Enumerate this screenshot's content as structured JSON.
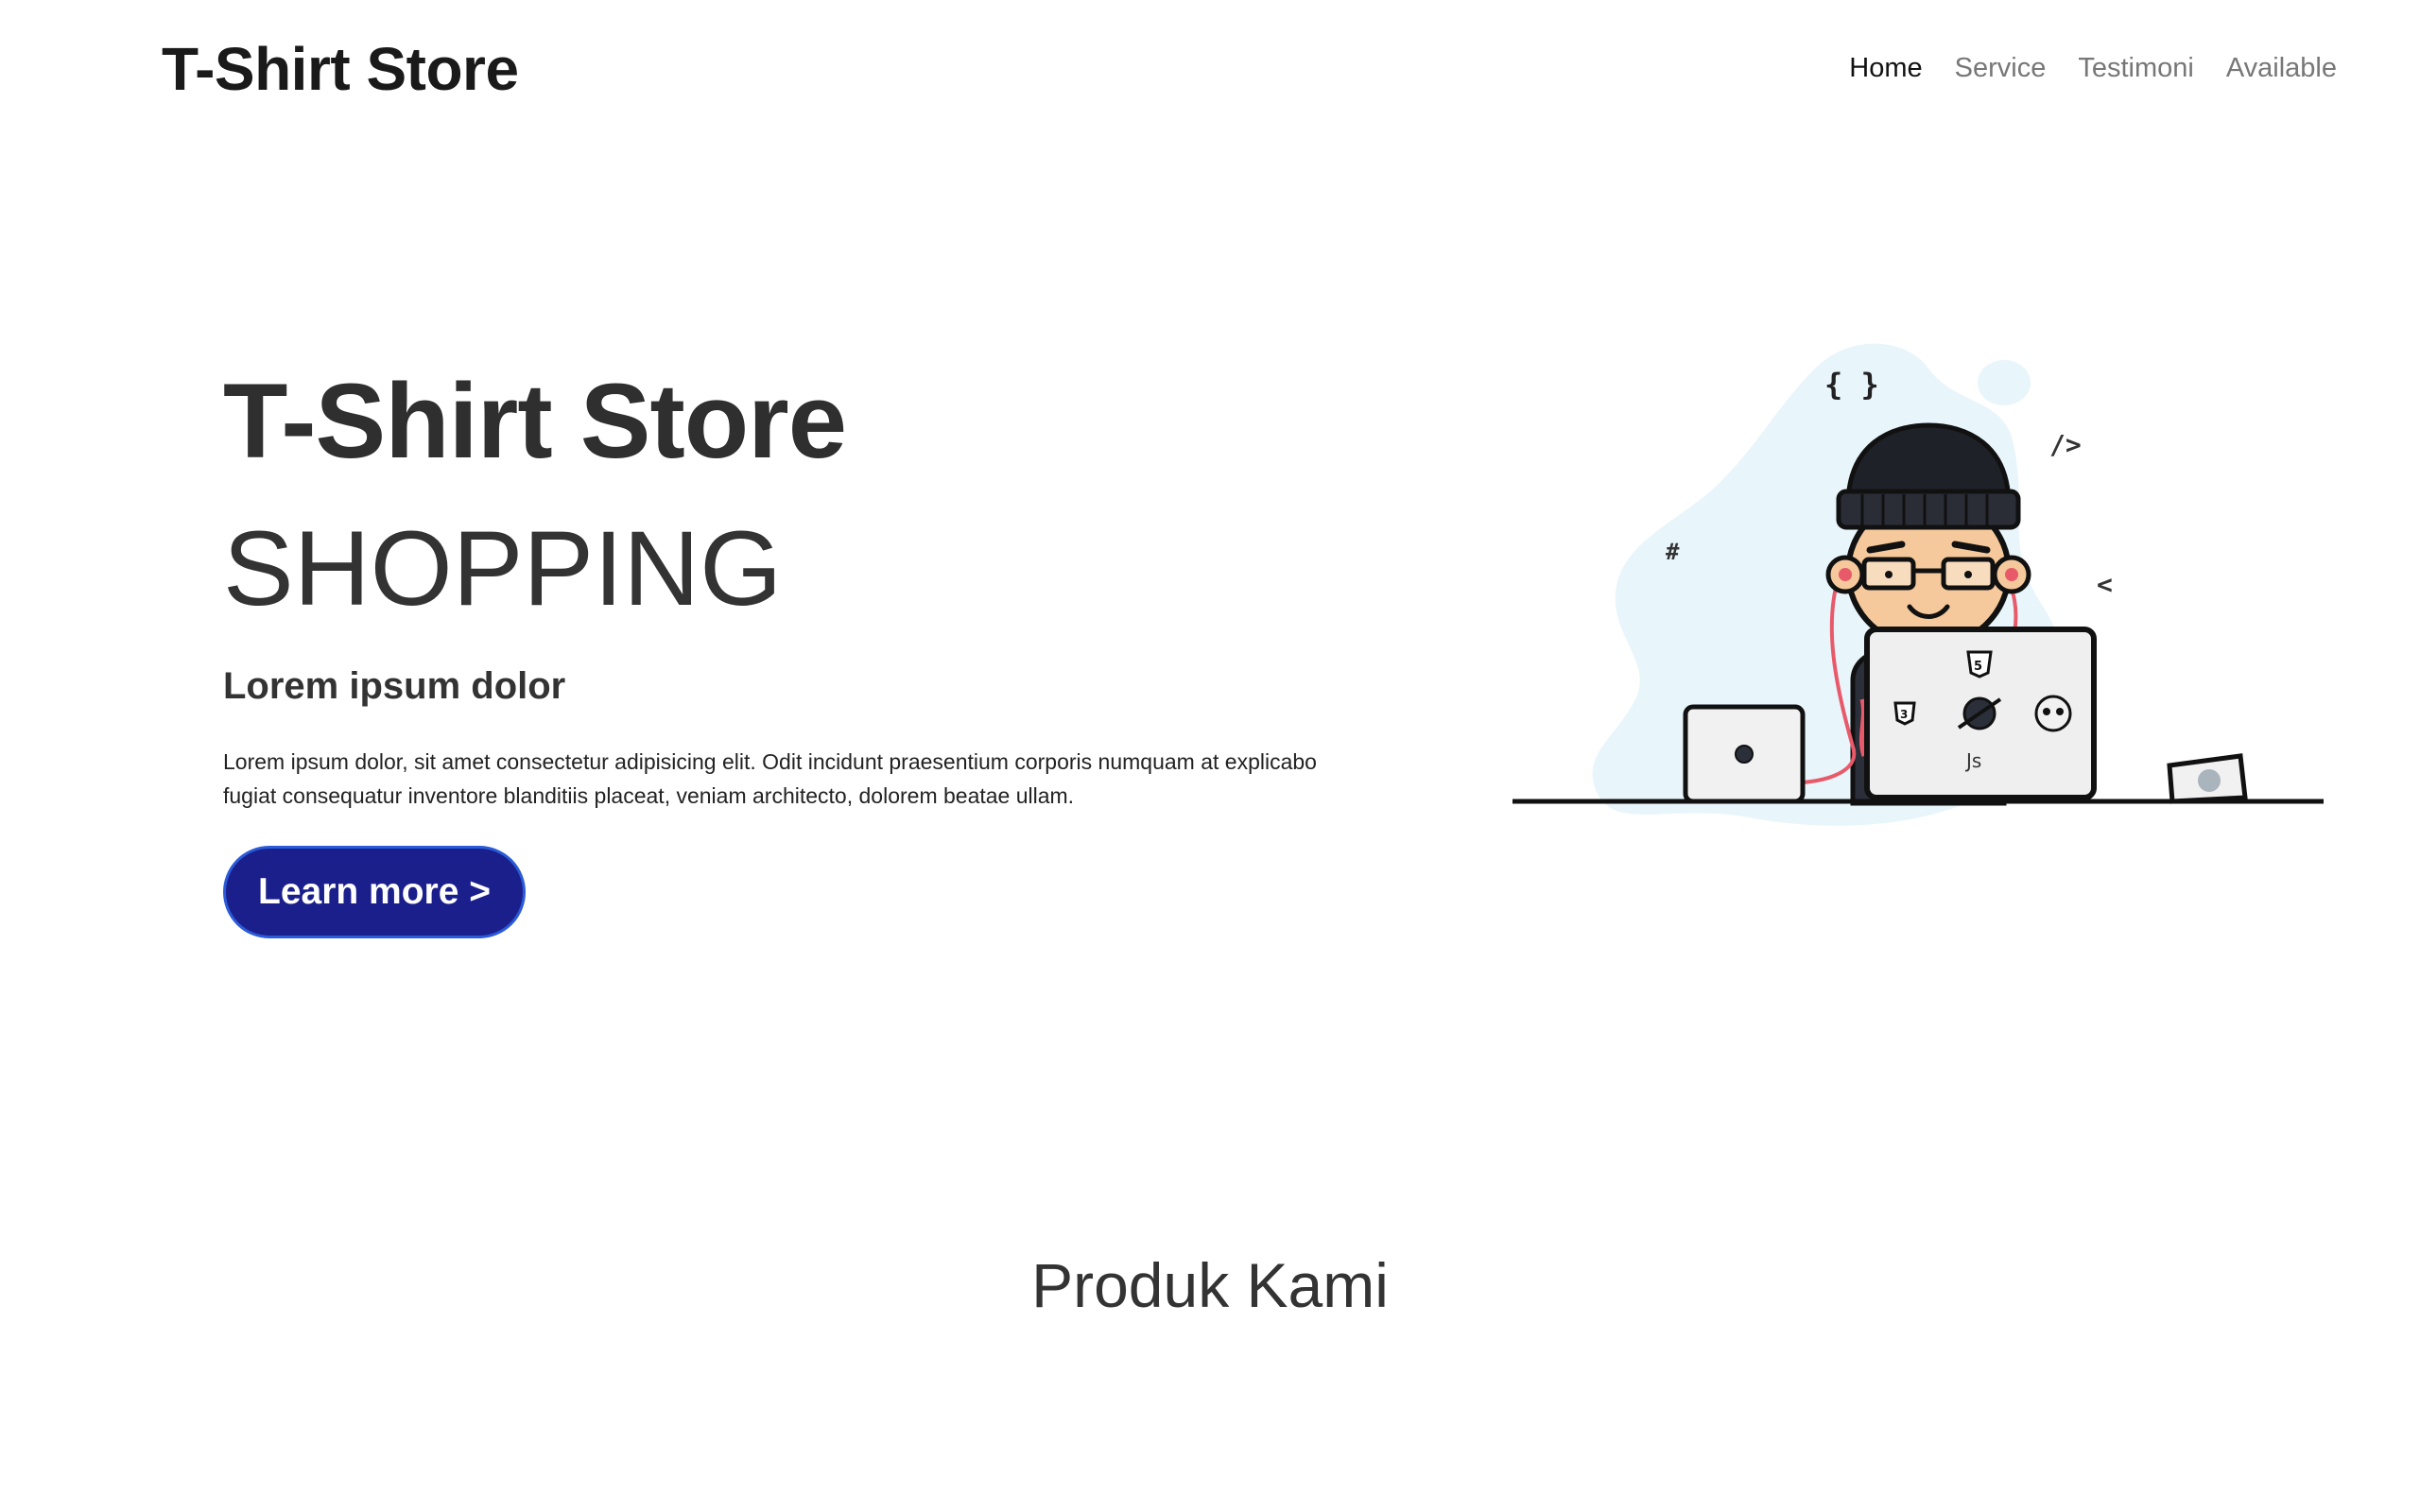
{
  "brand": "T-Shirt Store",
  "nav": {
    "items": [
      {
        "label": "Home",
        "active": true
      },
      {
        "label": "Service",
        "active": false
      },
      {
        "label": "Testimoni",
        "active": false
      },
      {
        "label": "Available",
        "active": false
      }
    ]
  },
  "hero": {
    "title": "T-Shirt Store",
    "subtitle": "SHOPPING",
    "lead": "Lorem ipsum dolor",
    "description": "Lorem ipsum dolor, sit amet consectetur adipisicing elit. Odit incidunt praesentium corporis numquam at explicabo fugiat consequatur inventore blanditiis placeat, veniam architecto, dolorem beatae ullam.",
    "cta_label": "Learn more >",
    "illustration": {
      "icon_name": "developer-at-laptop-illustration",
      "symbols": [
        "{ }",
        "/>",
        "#",
        "<",
        "Js"
      ]
    }
  },
  "products": {
    "heading": "Produk Kami"
  },
  "colors": {
    "cta_bg": "#1a1f8c",
    "cta_border": "#2b5bd8",
    "blob": "#e8f5fb"
  }
}
